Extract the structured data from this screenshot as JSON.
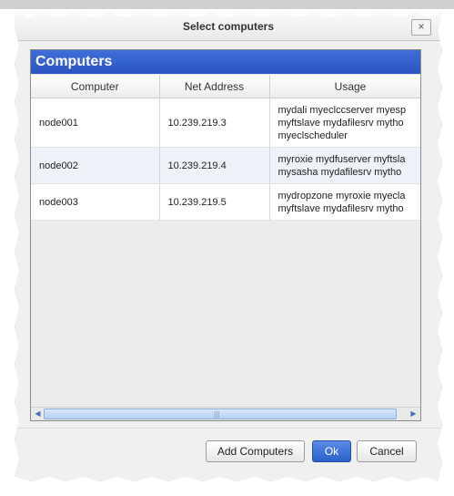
{
  "dialog": {
    "title": "Select computers",
    "close_label": "×"
  },
  "panel": {
    "title": "Computers"
  },
  "table": {
    "columns": [
      "Computer",
      "Net Address",
      "Usage"
    ],
    "rows": [
      {
        "computer": "node001",
        "address": "10.239.219.3",
        "usage_lines": [
          "mydali myeclccserver myesp",
          "myftslave mydafilesrv mytho",
          "myeclscheduler"
        ]
      },
      {
        "computer": "node002",
        "address": "10.239.219.4",
        "usage_lines": [
          "myroxie mydfuserver myftsla",
          "mysasha mydafilesrv mytho"
        ]
      },
      {
        "computer": "node003",
        "address": "10.239.219.5",
        "usage_lines": [
          "mydropzone myroxie myecla",
          "myftslave mydafilesrv mytho"
        ]
      }
    ]
  },
  "scrollbar": {
    "left_arrow": "◀",
    "right_arrow": "▶",
    "grip": "|||"
  },
  "buttons": {
    "add_computers": "Add Computers",
    "ok": "Ok",
    "cancel": "Cancel"
  },
  "colors": {
    "header_blue": "#2b54c2",
    "primary_button": "#2a60c9",
    "alt_row": "#eef3fb"
  }
}
